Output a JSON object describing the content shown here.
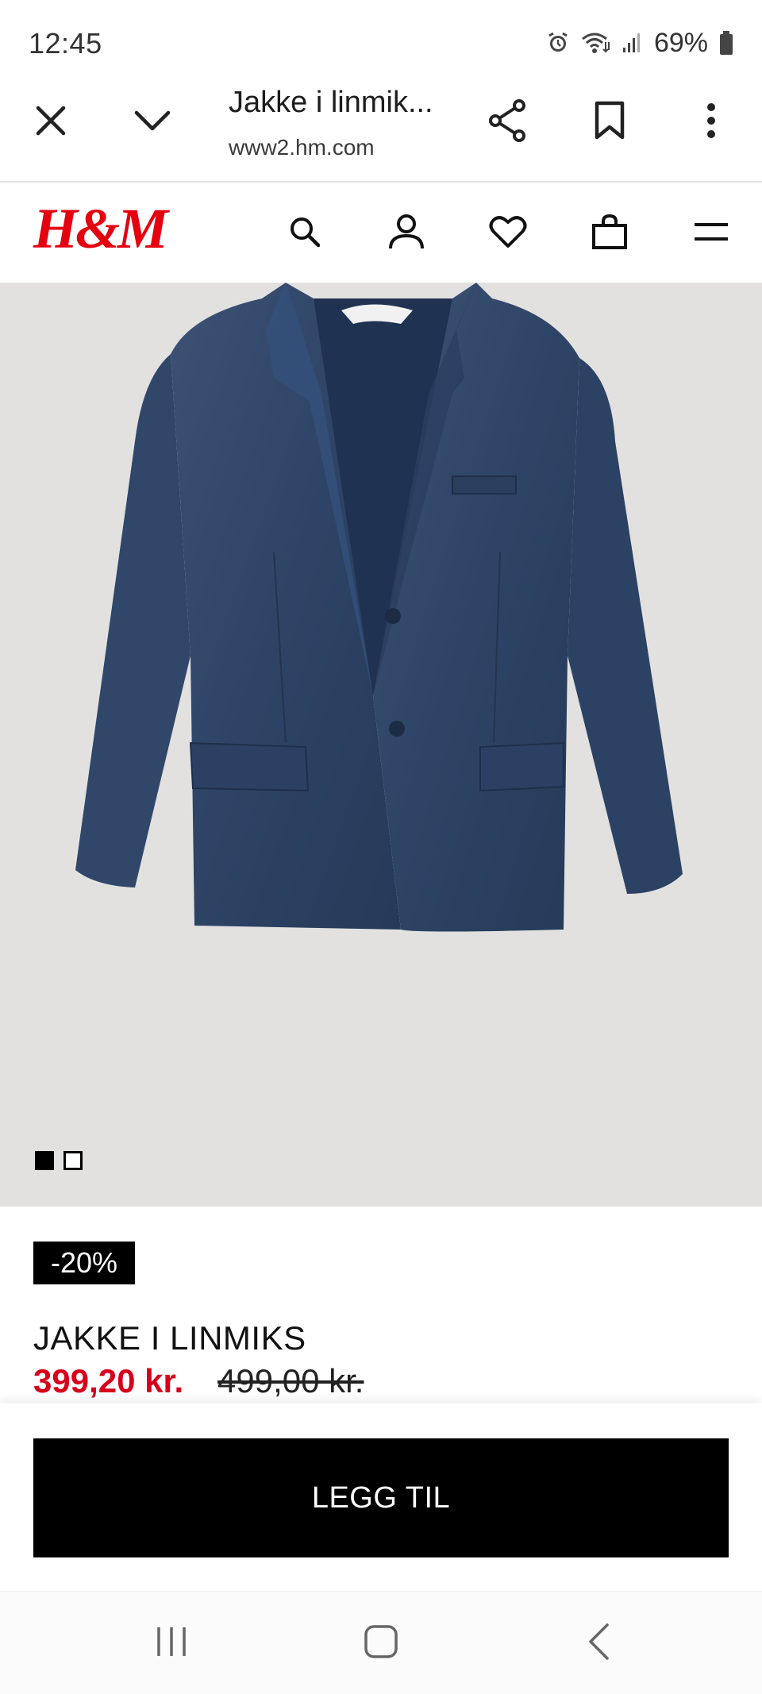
{
  "status_bar": {
    "time": "12:45",
    "battery": "69%",
    "icons": [
      "alarm-icon",
      "wifi-icon",
      "signal-icon",
      "battery-icon"
    ]
  },
  "browser": {
    "title": "Jakke i linmik...",
    "url": "www2.hm.com",
    "icons": [
      "close-icon",
      "chevron-down-icon",
      "share-icon",
      "bookmark-icon",
      "more-vertical-icon"
    ]
  },
  "site_header": {
    "logo": "H&M",
    "icons": [
      "search-icon",
      "account-icon",
      "favorites-icon",
      "bag-icon",
      "menu-icon"
    ],
    "brand_color": "#e50010"
  },
  "gallery": {
    "image_count": 2,
    "active_index": 0
  },
  "product": {
    "discount_badge": "-20%",
    "name": "JAKKE I LINMIKS",
    "sale_price": "399,20 kr.",
    "original_price": "499,00 kr.",
    "sale_color": "#d6001c"
  },
  "cta": {
    "label": "LEGG TIL"
  },
  "system_nav": {
    "icons": [
      "recents-icon",
      "home-icon",
      "back-icon"
    ]
  }
}
